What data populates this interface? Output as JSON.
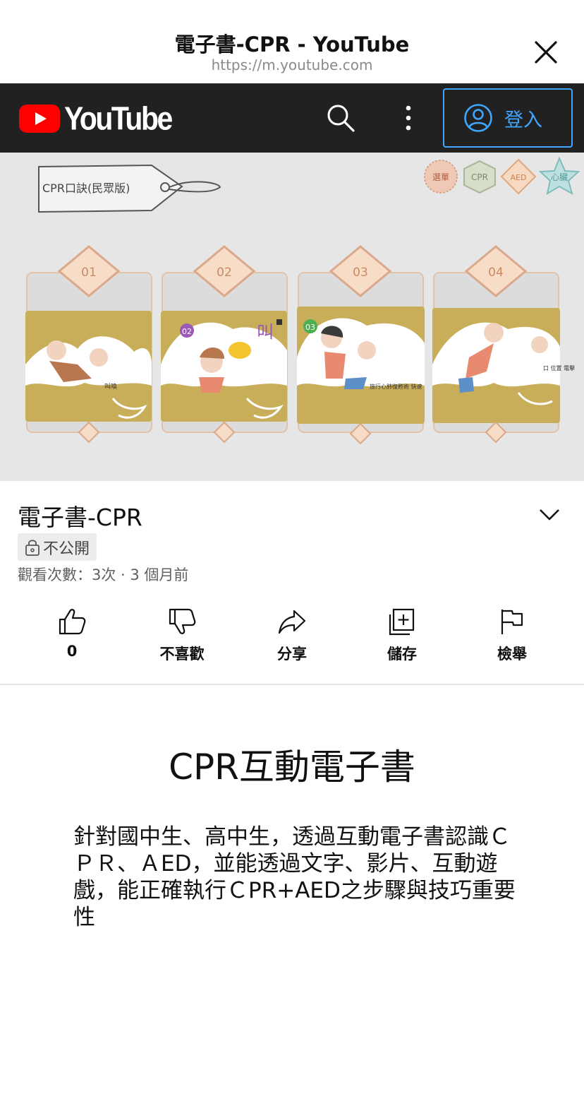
{
  "sheet": {
    "title": "電子書-CPR - YouTube",
    "url": "https://m.youtube.com"
  },
  "header": {
    "logo_text": "YouTube",
    "signin_label": "登入",
    "icons": [
      "search-icon",
      "more-vert-icon",
      "account-icon"
    ]
  },
  "thumbnail": {
    "tag_label": "CPR口訣(民眾版)",
    "badges": [
      "選單",
      "CPR",
      "AED",
      "心臟"
    ],
    "steps": [
      {
        "num": "01",
        "caption": "叫喚"
      },
      {
        "num": "02",
        "caption": "叫",
        "tag": "02"
      },
      {
        "num": "03",
        "caption": "施行心肺復甦術 快速",
        "tag": "03"
      },
      {
        "num": "04",
        "caption": "口 位置 電擊"
      }
    ]
  },
  "video": {
    "title": "電子書-CPR",
    "privacy": "不公開",
    "meta": "觀看次數：3次 · 3 個月前"
  },
  "actions": {
    "like_count": "0",
    "dislike": "不喜歡",
    "share": "分享",
    "save": "儲存",
    "report": "檢舉"
  },
  "description": {
    "heading": "CPR互動電子書",
    "body": "針對國中生、高中生，透過互動電子書認識ＣＰＲ、ＡED，並能透過文字、影片、互動遊戲，能正確執行ＣPR+AED之步驟與技巧重要性"
  },
  "colors": {
    "youtube_red": "#ff0000",
    "header_bg": "#212121",
    "signin_blue": "#3ea6ff",
    "thumb_gold": "#c9ae5a"
  }
}
